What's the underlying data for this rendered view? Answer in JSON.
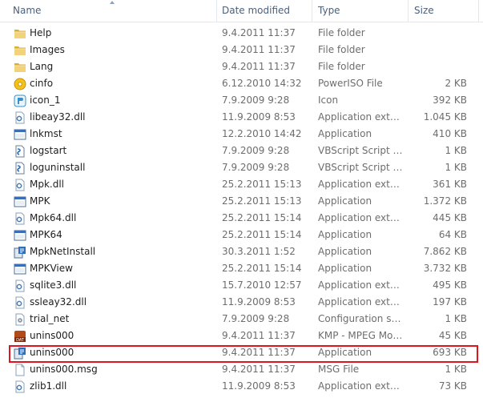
{
  "columns": {
    "name": "Name",
    "date_modified": "Date modified",
    "type": "Type",
    "size": "Size"
  },
  "files": [
    {
      "name": "Help",
      "date": "9.4.2011 11:37",
      "type": "File folder",
      "size": "",
      "icon": "folder-icon"
    },
    {
      "name": "Images",
      "date": "9.4.2011 11:37",
      "type": "File folder",
      "size": "",
      "icon": "folder-icon"
    },
    {
      "name": "Lang",
      "date": "9.4.2011 11:37",
      "type": "File folder",
      "size": "",
      "icon": "folder-icon"
    },
    {
      "name": "cinfo",
      "date": "6.12.2010 14:32",
      "type": "PowerISO File",
      "size": "2 KB",
      "icon": "poweriso-file-icon"
    },
    {
      "name": "icon_1",
      "date": "7.9.2009 9:28",
      "type": "Icon",
      "size": "392 KB",
      "icon": "icon-file-icon"
    },
    {
      "name": "libeay32.dll",
      "date": "11.9.2009 8:53",
      "type": "Application extens...",
      "size": "1.045 KB",
      "icon": "dll-icon"
    },
    {
      "name": "lnkmst",
      "date": "12.2.2010 14:42",
      "type": "Application",
      "size": "410 KB",
      "icon": "application-icon"
    },
    {
      "name": "logstart",
      "date": "7.9.2009 9:28",
      "type": "VBScript Script File",
      "size": "1 KB",
      "icon": "vbscript-icon"
    },
    {
      "name": "loguninstall",
      "date": "7.9.2009 9:28",
      "type": "VBScript Script File",
      "size": "1 KB",
      "icon": "vbscript-icon"
    },
    {
      "name": "Mpk.dll",
      "date": "25.2.2011 15:13",
      "type": "Application extens...",
      "size": "361 KB",
      "icon": "dll-icon"
    },
    {
      "name": "MPK",
      "date": "25.2.2011 15:13",
      "type": "Application",
      "size": "1.372 KB",
      "icon": "application-icon"
    },
    {
      "name": "Mpk64.dll",
      "date": "25.2.2011 15:14",
      "type": "Application extens...",
      "size": "445 KB",
      "icon": "dll-icon"
    },
    {
      "name": "MPK64",
      "date": "25.2.2011 15:14",
      "type": "Application",
      "size": "64 KB",
      "icon": "application-icon"
    },
    {
      "name": "MpkNetInstall",
      "date": "30.3.2011 1:52",
      "type": "Application",
      "size": "7.862 KB",
      "icon": "installer-icon"
    },
    {
      "name": "MPKView",
      "date": "25.2.2011 15:14",
      "type": "Application",
      "size": "3.732 KB",
      "icon": "application-icon"
    },
    {
      "name": "sqlite3.dll",
      "date": "15.7.2010 12:57",
      "type": "Application extens...",
      "size": "495 KB",
      "icon": "dll-icon"
    },
    {
      "name": "ssleay32.dll",
      "date": "11.9.2009 8:53",
      "type": "Application extens...",
      "size": "197 KB",
      "icon": "dll-icon"
    },
    {
      "name": "trial_net",
      "date": "7.9.2009 9:28",
      "type": "Configuration sett...",
      "size": "1 KB",
      "icon": "config-file-icon"
    },
    {
      "name": "unins000",
      "date": "9.4.2011 11:37",
      "type": "KMP - MPEG Mov...",
      "size": "45 KB",
      "icon": "kmp-dat-icon"
    },
    {
      "name": "unins000",
      "date": "9.4.2011 11:37",
      "type": "Application",
      "size": "693 KB",
      "icon": "uninstaller-icon",
      "highlighted": true
    },
    {
      "name": "unins000.msg",
      "date": "9.4.2011 11:37",
      "type": "MSG File",
      "size": "1 KB",
      "icon": "blank-file-icon"
    },
    {
      "name": "zlib1.dll",
      "date": "11.9.2009 8:53",
      "type": "Application extens...",
      "size": "73 KB",
      "icon": "dll-icon"
    }
  ],
  "colors": {
    "highlight_border": "#e0141c",
    "folder": "#e8c45a",
    "header_text": "#4c607a"
  }
}
